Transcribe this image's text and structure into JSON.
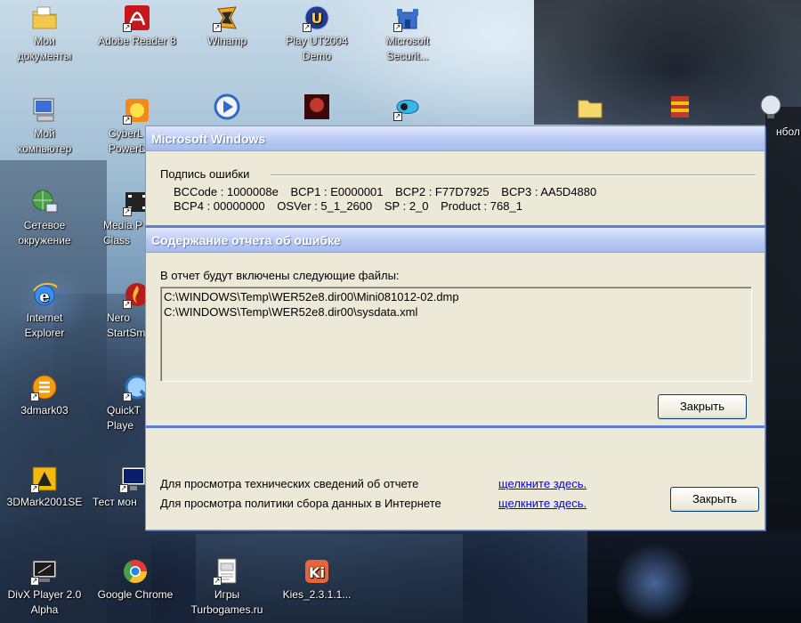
{
  "desktop": {
    "icons": [
      {
        "name": "my-documents-icon",
        "label": "Мои\nдокументы"
      },
      {
        "name": "adobe-reader-icon",
        "label": "Adobe Reader 8"
      },
      {
        "name": "winamp-icon",
        "label": "Winamp"
      },
      {
        "name": "play-ut2004-icon",
        "label": "Play UT2004\nDemo"
      },
      {
        "name": "microsoft-security-icon",
        "label": "Microsoft\nSecurit..."
      },
      {
        "name": "my-computer-icon",
        "label": "Мой\nкомпьютер"
      },
      {
        "name": "cyberlink-powerdvd-icon",
        "label": "CyberL\nPowerD"
      },
      {
        "name": "network-icon",
        "label": "Сетевое\nокружение"
      },
      {
        "name": "media-player-classic-icon",
        "label": "Media P\nClass"
      },
      {
        "name": "internet-explorer-icon",
        "label": "Internet\nExplorer"
      },
      {
        "name": "nero-startsmart-icon",
        "label": "Nero\nStartSm"
      },
      {
        "name": "3dmark03-icon",
        "label": "3dmark03"
      },
      {
        "name": "quicktime-player-icon",
        "label": "QuickT\nPlaye"
      },
      {
        "name": "3dmark2001se-icon",
        "label": "3DMark2001SE"
      },
      {
        "name": "test-monitor-icon",
        "label": "Тест мон"
      },
      {
        "name": "divx-player-icon",
        "label": "DivX Player 2.0\nAlpha"
      },
      {
        "name": "google-chrome-icon",
        "label": "Google Chrome"
      },
      {
        "name": "games-turbogames-icon",
        "label": "Игры\nTurbogames.ru"
      },
      {
        "name": "kies-icon",
        "label": "Kies_2.3.1.1..."
      },
      {
        "name": "partial-icon-right",
        "label": "нбол"
      }
    ]
  },
  "dialog": {
    "title": "Microsoft Windows",
    "signature_label": "Подпись ошибки",
    "params_row1": [
      "BCCode : 1000008e",
      "BCP1 : E0000001",
      "BCP2 : F77D7925",
      "BCP3 : AA5D4880"
    ],
    "params_row2": [
      "BCP4 : 00000000",
      "OSVer : 5_1_2600",
      "SP : 2_0",
      "Product : 768_1"
    ],
    "section_title": "Содержание отчета об ошибке",
    "files_intro": "В отчет будут включены следующие файлы:",
    "files": [
      "C:\\WINDOWS\\Temp\\WER52e8.dir00\\Mini081012-02.dmp",
      "C:\\WINDOWS\\Temp\\WER52e8.dir00\\sysdata.xml"
    ],
    "close_label_1": "Закрыть",
    "tech_details_text": "Для просмотра технических сведений об отчете",
    "tech_details_link": "щелкните здесь.",
    "policy_text": "Для просмотра политики сбора данных в Интернете",
    "policy_link": "щелкните здесь.",
    "close_label_2": "Закрыть"
  },
  "colors": {
    "dialog_bg": "#ece9d8",
    "header_band": "#b9c9f2",
    "separator_blue": "#5b7fd8",
    "link": "#0000ff"
  }
}
